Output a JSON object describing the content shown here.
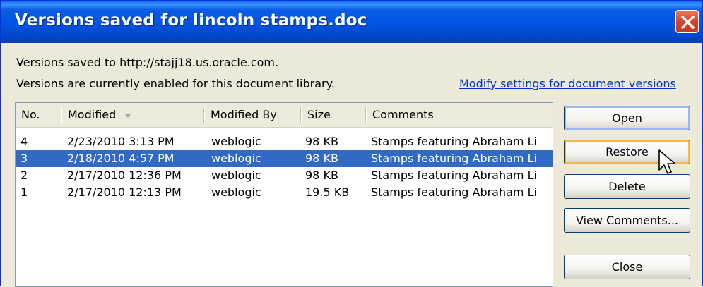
{
  "window": {
    "title": "Versions saved for lincoln stamps.doc"
  },
  "info": {
    "line1": "Versions saved to http://stajj18.us.oracle.com.",
    "line2": "Versions are currently enabled for this document library.",
    "settings_link": "Modify settings for document versions"
  },
  "list": {
    "headers": {
      "no": "No.",
      "modified": "Modified",
      "modified_by": "Modified By",
      "size": "Size",
      "comments": "Comments"
    },
    "rows": [
      {
        "no": "4",
        "modified": "2/23/2010 3:13 PM",
        "modified_by": "weblogic",
        "size": "98 KB",
        "comments": "Stamps featuring Abraham Li",
        "selected": false
      },
      {
        "no": "3",
        "modified": "2/18/2010 4:57 PM",
        "modified_by": "weblogic",
        "size": "98 KB",
        "comments": "Stamps featuring Abraham Li",
        "selected": true
      },
      {
        "no": "2",
        "modified": "2/17/2010 12:36 PM",
        "modified_by": "weblogic",
        "size": "98 KB",
        "comments": "Stamps featuring Abraham Li",
        "selected": false
      },
      {
        "no": "1",
        "modified": "2/17/2010 12:13 PM",
        "modified_by": "weblogic",
        "size": "19.5 KB",
        "comments": "Stamps featuring Abraham Li",
        "selected": false
      }
    ]
  },
  "buttons": {
    "open": "Open",
    "restore": "Restore",
    "delete": "Delete",
    "view_comments": "View Comments...",
    "close": "Close"
  },
  "colors": {
    "titlebar": "#0054e3",
    "selection": "#316ac5",
    "link": "#0033cc",
    "face": "#ece9d8"
  },
  "icons": {
    "close": "close-icon",
    "sort": "sort-descending-icon",
    "cursor": "mouse-pointer-icon"
  }
}
